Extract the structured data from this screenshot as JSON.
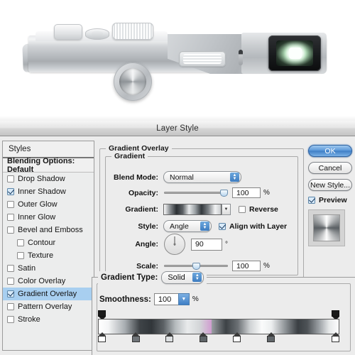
{
  "artwork": {
    "name": "camera-top-render",
    "description": "Silver digital camera top/front render"
  },
  "dialog": {
    "title": "Layer Style"
  },
  "styles_pane": {
    "header": "Styles",
    "blending_options": "Blending Options: Default",
    "items": [
      {
        "label": "Drop Shadow",
        "checked": false,
        "sub": false,
        "selected": false
      },
      {
        "label": "Inner Shadow",
        "checked": true,
        "sub": false,
        "selected": false
      },
      {
        "label": "Outer Glow",
        "checked": false,
        "sub": false,
        "selected": false
      },
      {
        "label": "Inner Glow",
        "checked": false,
        "sub": false,
        "selected": false
      },
      {
        "label": "Bevel and Emboss",
        "checked": false,
        "sub": false,
        "selected": false
      },
      {
        "label": "Contour",
        "checked": false,
        "sub": true,
        "selected": false
      },
      {
        "label": "Texture",
        "checked": false,
        "sub": true,
        "selected": false
      },
      {
        "label": "Satin",
        "checked": false,
        "sub": false,
        "selected": false
      },
      {
        "label": "Color Overlay",
        "checked": false,
        "sub": false,
        "selected": false
      },
      {
        "label": "Gradient Overlay",
        "checked": true,
        "sub": false,
        "selected": true
      },
      {
        "label": "Pattern Overlay",
        "checked": false,
        "sub": false,
        "selected": false
      },
      {
        "label": "Stroke",
        "checked": false,
        "sub": false,
        "selected": false
      }
    ]
  },
  "panel": {
    "section_title": "Gradient Overlay",
    "group_title": "Gradient",
    "blend_mode": {
      "label": "Blend Mode:",
      "value": "Normal"
    },
    "opacity": {
      "label": "Opacity:",
      "value": "100",
      "unit": "%",
      "percent": 100
    },
    "gradient": {
      "label": "Gradient:"
    },
    "reverse": {
      "label": "Reverse",
      "checked": false
    },
    "style": {
      "label": "Style:",
      "value": "Angle"
    },
    "align_with_layer": {
      "label": "Align with Layer",
      "checked": true
    },
    "angle": {
      "label": "Angle:",
      "value": "90",
      "unit": "°"
    },
    "scale": {
      "label": "Scale:",
      "value": "100",
      "unit": "%",
      "percent": 50
    }
  },
  "buttons": {
    "ok": "OK",
    "cancel": "Cancel",
    "new_style": "New Style...",
    "preview": {
      "label": "Preview",
      "checked": true
    }
  },
  "gradient_editor": {
    "gradient_type": {
      "label": "Gradient Type:",
      "value": "Solid"
    },
    "smoothness": {
      "label": "Smoothness:",
      "value": "100",
      "unit": "%"
    },
    "opacity_stops": [
      0,
      100
    ],
    "color_stops": [
      0,
      14,
      28,
      42,
      56,
      70,
      100
    ]
  },
  "colors": {
    "accent_blue": "#3f7fc6",
    "selection_blue": "#a8cff0",
    "dialog_bg": "#ececec"
  }
}
